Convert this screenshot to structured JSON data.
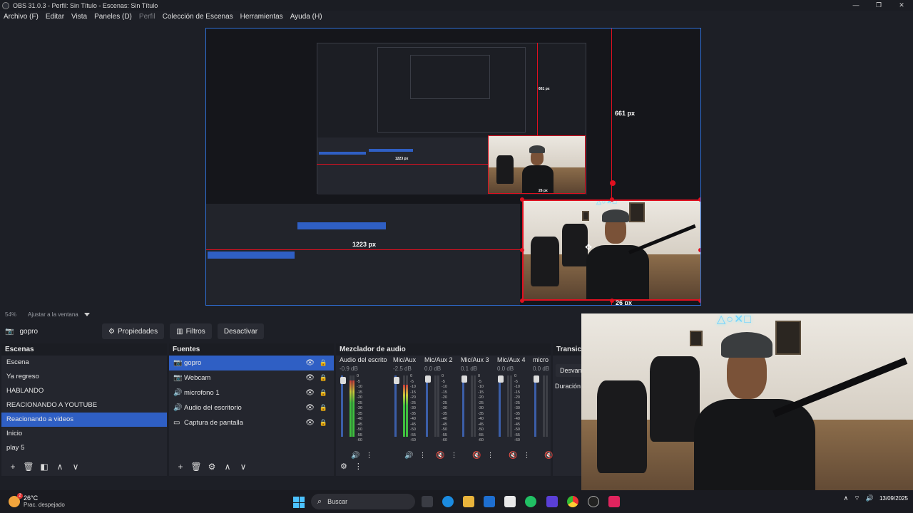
{
  "window": {
    "title": "OBS 31.0.3 - Perfil: Sin Título - Escenas: Sin Título",
    "minimize": "—",
    "maximize": "❐",
    "close": "✕"
  },
  "menu": [
    {
      "label": "Archivo (F)",
      "enabled": true
    },
    {
      "label": "Editar",
      "enabled": true
    },
    {
      "label": "Vista",
      "enabled": true
    },
    {
      "label": "Paneles (D)",
      "enabled": true
    },
    {
      "label": "Perfil",
      "enabled": false
    },
    {
      "label": "Colección de Escenas",
      "enabled": true
    },
    {
      "label": "Herramientas",
      "enabled": true
    },
    {
      "label": "Ayuda (H)",
      "enabled": true
    }
  ],
  "preview": {
    "label_height": "661 px",
    "label_left": "1223 px",
    "label_bottom": "26 px",
    "nested_label_height": "661 px",
    "nested_label_left": "1223 px",
    "nested_label_bottom": "26 px",
    "neon_text": "△○✕□"
  },
  "zoom": {
    "percent": "54%",
    "mode": "Ajustar a la ventana"
  },
  "source_toolbar": {
    "current_source": "gopro",
    "properties": "Propiedades",
    "filters": "Filtros",
    "deactivate": "Desactivar"
  },
  "scenes": {
    "header": "Escenas",
    "items": [
      "Escena",
      "Ya regreso",
      "HABLANDO",
      "REACIONANDO A YOUTUBE",
      "Reacionando a videos",
      "Inicio",
      "play 5"
    ],
    "selected_index": 4
  },
  "sources": {
    "header": "Fuentes",
    "items": [
      {
        "name": "gopro",
        "icon": "camera-icon",
        "glyph": "📷"
      },
      {
        "name": "Webcam",
        "icon": "camera-icon",
        "glyph": "📷"
      },
      {
        "name": "microfono 1",
        "icon": "speaker-icon",
        "glyph": "🔊"
      },
      {
        "name": "Audio del escritorio",
        "icon": "speaker-icon",
        "glyph": "🔊"
      },
      {
        "name": "Captura de pantalla",
        "icon": "monitor-icon",
        "glyph": "▭"
      }
    ],
    "selected_index": 0
  },
  "mixer": {
    "header": "Mezclador de audio",
    "channels": [
      {
        "name": "Audio del escrito",
        "db": "-0.9 dB",
        "level": 0.92,
        "muted": false
      },
      {
        "name": "Mic/Aux",
        "db": "-2.5 dB",
        "level": 0.85,
        "muted": false
      },
      {
        "name": "Mic/Aux 2",
        "db": "0.0 dB",
        "level": 0.0,
        "muted": true
      },
      {
        "name": "Mic/Aux 3",
        "db": "0.1 dB",
        "level": 0.0,
        "muted": true
      },
      {
        "name": "Mic/Aux 4",
        "db": "0.0 dB",
        "level": 0.0,
        "muted": true
      },
      {
        "name": "micro",
        "db": "0.0 dB",
        "level": 0.0,
        "muted": true
      }
    ],
    "scale": [
      "0",
      "-5",
      "-10",
      "-15",
      "-20",
      "-25",
      "-30",
      "-35",
      "-40",
      "-45",
      "-50",
      "-55",
      "-60"
    ]
  },
  "transitions": {
    "header": "Transici",
    "button": "Desvan",
    "duration": "Duración"
  },
  "taskbar": {
    "temperature": "26°C",
    "condition": "Prac. despejado",
    "search": "Buscar",
    "date": "13/09/2025",
    "weather_badge": "2"
  },
  "colors": {
    "accent": "#2f5fc4",
    "selection": "#e01020",
    "preview_border": "#2f6fd6",
    "mute_red": "#b03038"
  }
}
